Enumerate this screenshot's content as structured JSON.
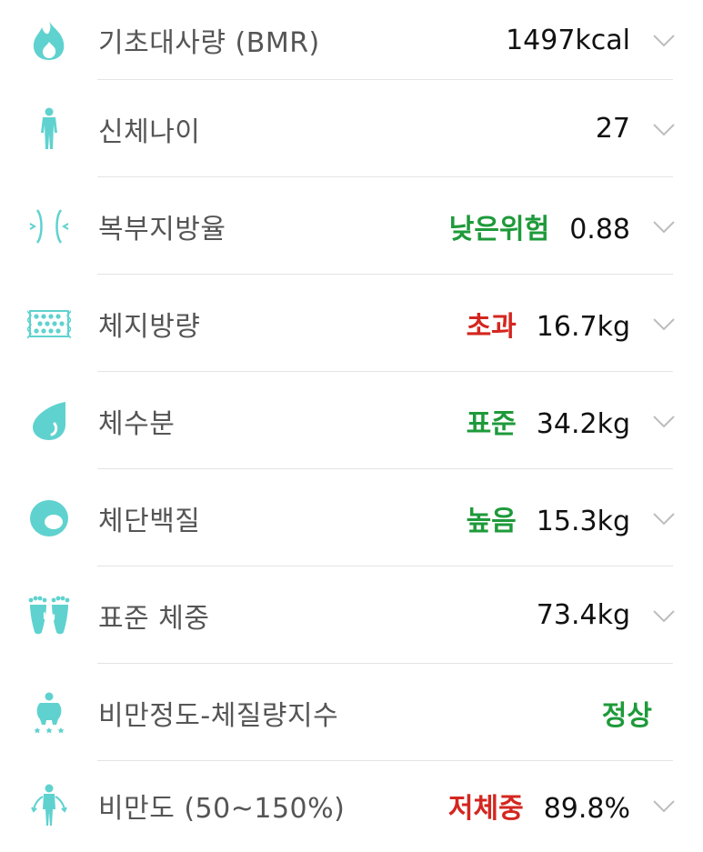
{
  "colors": {
    "icon_teal": "#5fd2cf",
    "status_green": "#1e9a3a",
    "status_red": "#d4261f",
    "label_gray": "#555555",
    "value_black": "#111111",
    "chevron_gray": "#bdbdbd"
  },
  "rows": [
    {
      "icon": "flame-icon",
      "label": "기초대사량 (BMR)",
      "status": "",
      "value": "1497kcal",
      "has_chevron": true
    },
    {
      "icon": "body-icon",
      "label": "신체나이",
      "status": "",
      "value": "27",
      "has_chevron": true
    },
    {
      "icon": "waist-icon",
      "label": "복부지방율",
      "status": "낮은위험",
      "status_color": "green",
      "value": "0.88",
      "has_chevron": true
    },
    {
      "icon": "fat-mesh-icon",
      "label": "체지방량",
      "status": "초과",
      "status_color": "red",
      "value": "16.7kg",
      "has_chevron": true
    },
    {
      "icon": "water-drop-icon",
      "label": "체수분",
      "status": "표준",
      "status_color": "green",
      "value": "34.2kg",
      "has_chevron": true
    },
    {
      "icon": "egg-icon",
      "label": "체단백질",
      "status": "높음",
      "status_color": "green",
      "value": "15.3kg",
      "has_chevron": true
    },
    {
      "icon": "footprints-kg-icon",
      "label": "표준 체중",
      "status": "",
      "value": "73.4kg",
      "has_chevron": true
    },
    {
      "icon": "obese-person-icon",
      "label": "비만정도-체질량지수",
      "status": "정상",
      "status_color": "green",
      "value": "",
      "has_chevron": false
    },
    {
      "icon": "person-scale-icon",
      "label": "비만도 (50~150%)",
      "status": "저체중",
      "status_color": "red",
      "value": "89.8%",
      "has_chevron": true
    }
  ]
}
